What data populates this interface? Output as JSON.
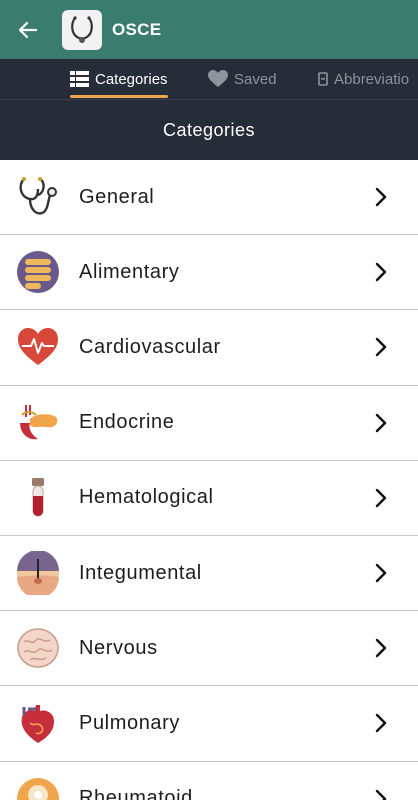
{
  "app": {
    "title": "OSCE"
  },
  "tabs": [
    {
      "label": "Categories",
      "icon": "list-icon"
    },
    {
      "label": "Saved",
      "icon": "heart-icon"
    },
    {
      "label": "Abbreviatio",
      "icon": "abbreviation-icon"
    }
  ],
  "section": {
    "title": "Categories"
  },
  "categories": [
    {
      "label": "General",
      "icon": "stethoscope-icon"
    },
    {
      "label": "Alimentary",
      "icon": "intestine-icon"
    },
    {
      "label": "Cardiovascular",
      "icon": "heart-pulse-icon"
    },
    {
      "label": "Endocrine",
      "icon": "pancreas-icon"
    },
    {
      "label": "Hematological",
      "icon": "blood-tube-icon"
    },
    {
      "label": "Integumental",
      "icon": "skin-icon"
    },
    {
      "label": "Nervous",
      "icon": "brain-icon"
    },
    {
      "label": "Pulmonary",
      "icon": "organ-heart-icon"
    },
    {
      "label": "Rheumatoid",
      "icon": "joint-icon"
    }
  ],
  "colors": {
    "appbar": "#3a7d6e",
    "tabbar": "#262c38",
    "accent": "#f0a44b",
    "inactive_tab": "#8e939c"
  }
}
